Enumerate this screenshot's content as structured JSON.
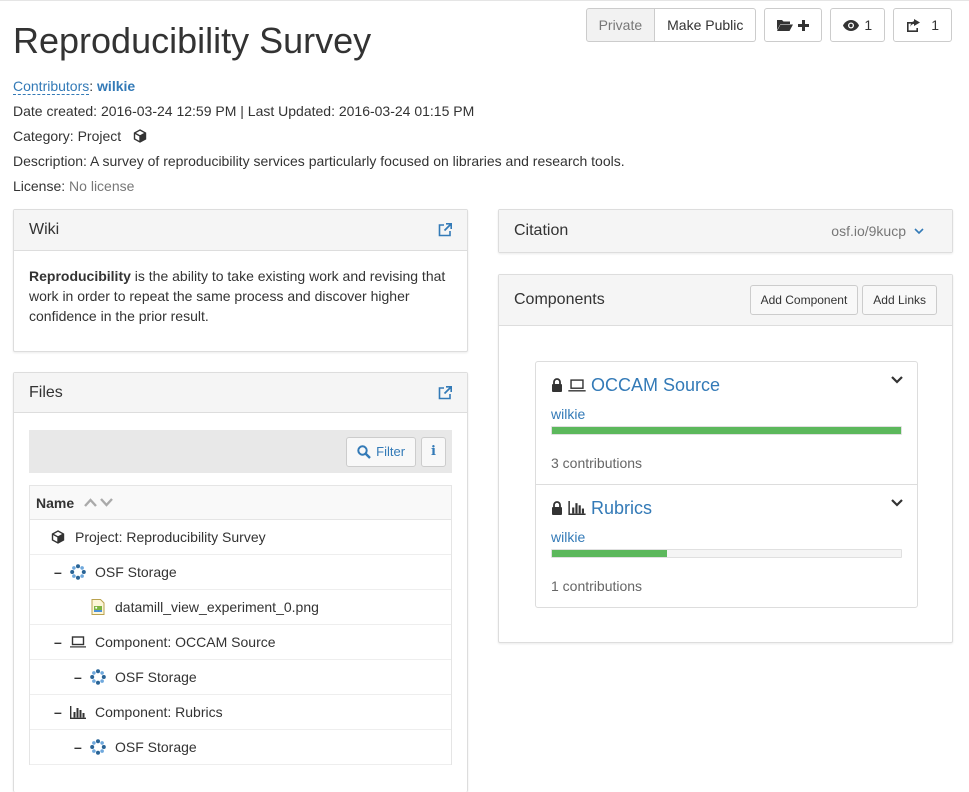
{
  "header": {
    "title": "Reproducibility Survey",
    "privacy_label": "Private",
    "make_public_label": "Make Public",
    "watch_count": "1",
    "fork_count": "1"
  },
  "meta": {
    "contributors_label": "Contributors",
    "contributor": "wilkie",
    "dates": "Date created: 2016-03-24 12:59 PM | Last Updated: 2016-03-24 01:15 PM",
    "category_label": "Category:",
    "category_value": "Project",
    "description_label": "Description:",
    "description_value": "A survey of reproducibility services particularly focused on libraries and research tools.",
    "license_label": "License:",
    "license_value": "No license"
  },
  "wiki": {
    "title": "Wiki",
    "term": "Reproducibility",
    "text": " is the ability to take existing work and revising that work in order to repeat the same process and discover higher confidence in the prior result."
  },
  "files": {
    "title": "Files",
    "filter_label": "Filter",
    "column_name": "Name",
    "rows": [
      {
        "label": "Project: Reproducibility Survey",
        "icon": "cube-icon"
      },
      {
        "label": "OSF Storage",
        "icon": "osf-storage-icon"
      },
      {
        "label": "datamill_view_experiment_0.png",
        "icon": "image-file-icon"
      },
      {
        "label": "Component: OCCAM Source",
        "icon": "laptop-icon"
      },
      {
        "label": "OSF Storage",
        "icon": "osf-storage-icon"
      },
      {
        "label": "Component: Rubrics",
        "icon": "bar-chart-icon"
      },
      {
        "label": "OSF Storage",
        "icon": "osf-storage-icon"
      }
    ]
  },
  "citation": {
    "title": "Citation",
    "link": "osf.io/9kucp"
  },
  "components": {
    "title": "Components",
    "add_component_label": "Add Component",
    "add_links_label": "Add Links",
    "items": [
      {
        "name": "OCCAM Source",
        "icon": "laptop-icon",
        "user": "wilkie",
        "progress": 1.0,
        "count": "3 contributions"
      },
      {
        "name": "Rubrics",
        "icon": "bar-chart-icon",
        "user": "wilkie",
        "progress": 0.33,
        "count": "1 contributions"
      }
    ]
  },
  "colors": {
    "link": "#337ab7",
    "progress": "#5cb85c",
    "panel_header": "#f5f5f5"
  }
}
